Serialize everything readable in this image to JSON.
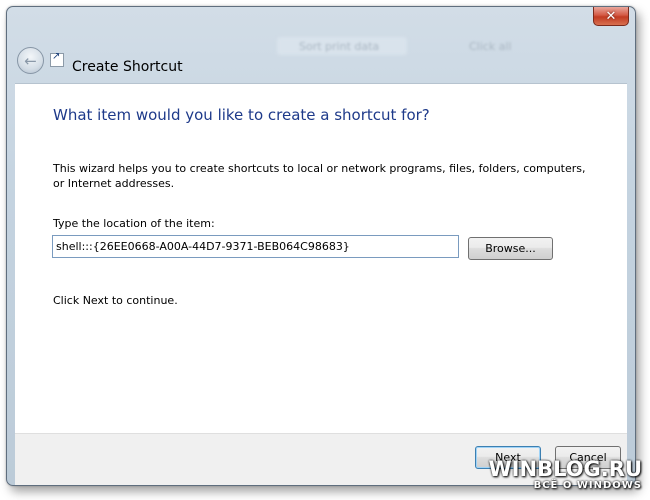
{
  "window": {
    "title": "Create Shortcut",
    "close_glyph": "✕",
    "back_glyph": "←",
    "ghost_search": "Sort print data",
    "ghost_view": "Click all"
  },
  "wizard": {
    "heading": "What item would you like to create a shortcut for?",
    "description": "This wizard helps you to create shortcuts to local or network programs, files, folders, computers, or Internet addresses.",
    "location_label": "Type the location of the item:",
    "location_value": "shell:::{26EE0668-A00A-44D7-9371-BEB064C98683}",
    "browse_label": "Browse...",
    "continue_text": "Click Next to continue."
  },
  "footer": {
    "next_label": "Next",
    "cancel_label": "Cancel"
  },
  "watermark": {
    "main": "WINBLOG.RU",
    "sub": "ВСЁ О WINDOWS"
  },
  "colors": {
    "heading": "#1e3a8a",
    "close_button": "#c23b22",
    "frame": "#c4d3e0"
  }
}
